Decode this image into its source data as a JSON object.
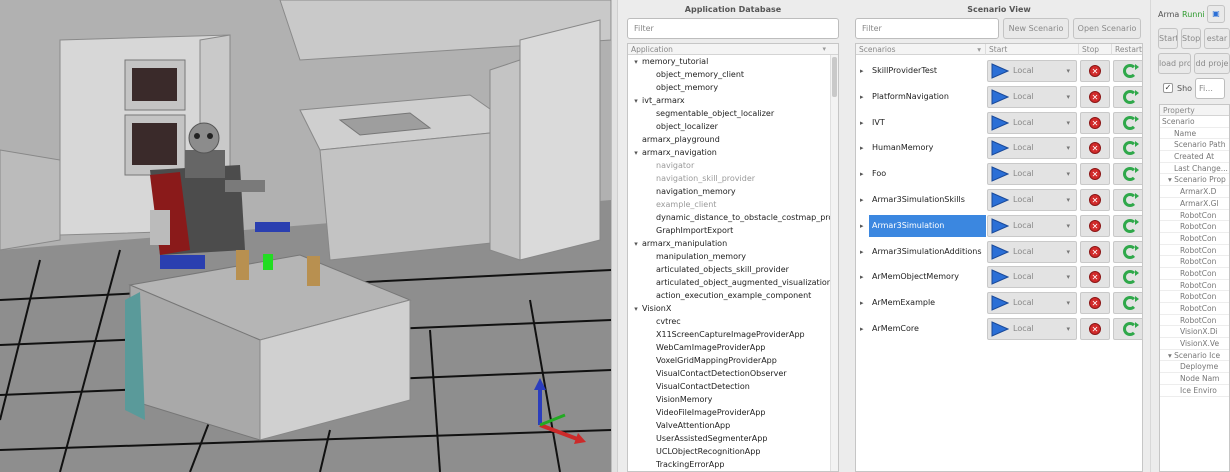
{
  "app_db": {
    "title": "Application Database",
    "filter_placeholder": "Filter",
    "column_header": "Application",
    "tree": [
      {
        "label": "memory_tutorial",
        "level": 0,
        "expanded": true,
        "dim": false
      },
      {
        "label": "object_memory_client",
        "level": 1,
        "dim": false
      },
      {
        "label": "object_memory",
        "level": 1,
        "dim": false
      },
      {
        "label": "ivt_armarx",
        "level": 0,
        "expanded": true,
        "dim": false
      },
      {
        "label": "segmentable_object_localizer",
        "level": 1,
        "dim": false
      },
      {
        "label": "object_localizer",
        "level": 1,
        "dim": false
      },
      {
        "label": "armarx_playground",
        "level": 0,
        "expanded": false,
        "dim": false
      },
      {
        "label": "armarx_navigation",
        "level": 0,
        "expanded": true,
        "dim": false
      },
      {
        "label": "navigator",
        "level": 1,
        "dim": true
      },
      {
        "label": "navigation_skill_provider",
        "level": 1,
        "dim": true
      },
      {
        "label": "navigation_memory",
        "level": 1,
        "dim": false
      },
      {
        "label": "example_client",
        "level": 1,
        "dim": true
      },
      {
        "label": "dynamic_distance_to_obstacle_costmap_pro...",
        "level": 1,
        "dim": false
      },
      {
        "label": "GraphImportExport",
        "level": 1,
        "dim": false
      },
      {
        "label": "armarx_manipulation",
        "level": 0,
        "expanded": true,
        "dim": false
      },
      {
        "label": "manipulation_memory",
        "level": 1,
        "dim": false
      },
      {
        "label": "articulated_objects_skill_provider",
        "level": 1,
        "dim": false
      },
      {
        "label": "articulated_object_augmented_visualization",
        "level": 1,
        "dim": false
      },
      {
        "label": "action_execution_example_component",
        "level": 1,
        "dim": false
      },
      {
        "label": "VisionX",
        "level": 0,
        "expanded": true,
        "dim": false
      },
      {
        "label": "cvtrec",
        "level": 1,
        "dim": false
      },
      {
        "label": "X11ScreenCaptureImageProviderApp",
        "level": 1,
        "dim": false
      },
      {
        "label": "WebCamImageProviderApp",
        "level": 1,
        "dim": false
      },
      {
        "label": "VoxelGridMappingProviderApp",
        "level": 1,
        "dim": false
      },
      {
        "label": "VisualContactDetectionObserver",
        "level": 1,
        "dim": false
      },
      {
        "label": "VisualContactDetection",
        "level": 1,
        "dim": false
      },
      {
        "label": "VisionMemory",
        "level": 1,
        "dim": false
      },
      {
        "label": "VideoFileImageProviderApp",
        "level": 1,
        "dim": false
      },
      {
        "label": "ValveAttentionApp",
        "level": 1,
        "dim": false
      },
      {
        "label": "UserAssistedSegmenterApp",
        "level": 1,
        "dim": false
      },
      {
        "label": "UCLObjectRecognitionApp",
        "level": 1,
        "dim": false
      },
      {
        "label": "TrackingErrorApp",
        "level": 1,
        "dim": false
      }
    ]
  },
  "scenario_view": {
    "title": "Scenario View",
    "filter_placeholder": "Filter",
    "new_button": "New Scenario",
    "open_button": "Open Scenario",
    "headers": {
      "scenarios": "Scenarios",
      "start": "Start",
      "stop": "Stop",
      "restart": "Restart"
    },
    "start_mode": "Local",
    "scenarios": [
      {
        "name": "SkillProviderTest",
        "selected": false
      },
      {
        "name": "PlatformNavigation",
        "selected": false
      },
      {
        "name": "IVT",
        "selected": false
      },
      {
        "name": "HumanMemory",
        "selected": false
      },
      {
        "name": "Foo",
        "selected": false
      },
      {
        "name": "Armar3SimulationSkills",
        "selected": false
      },
      {
        "name": "Armar3Simulation",
        "selected": true
      },
      {
        "name": "Armar3SimulationAdditions",
        "selected": false
      },
      {
        "name": "ArMemObjectMemory",
        "selected": false
      },
      {
        "name": "ArMemExample",
        "selected": false
      },
      {
        "name": "ArMemCore",
        "selected": false
      }
    ]
  },
  "side_panel": {
    "name": "Arma",
    "status": "Runni",
    "status_color": "#2e9b2e",
    "start": "Start",
    "stop": "Stop",
    "restart": "estar",
    "load": "load proj",
    "add": "dd proje",
    "show_label": "Sho",
    "filter_placeholder": "Fi...",
    "property_header": "Property",
    "properties": [
      {
        "label": "Scenario",
        "indent": 0,
        "arrow": ""
      },
      {
        "label": "Name",
        "indent": 2,
        "arrow": ""
      },
      {
        "label": "Scenario Path",
        "indent": 2,
        "arrow": ""
      },
      {
        "label": "Created At",
        "indent": 2,
        "arrow": ""
      },
      {
        "label": "Last Change...",
        "indent": 2,
        "arrow": ""
      },
      {
        "label": "Scenario Prop",
        "indent": 1,
        "arrow": "▾"
      },
      {
        "label": "ArmarX.D",
        "indent": 3,
        "arrow": ""
      },
      {
        "label": "ArmarX.Gl",
        "indent": 3,
        "arrow": ""
      },
      {
        "label": "RobotCon",
        "indent": 3,
        "arrow": ""
      },
      {
        "label": "RobotCon",
        "indent": 3,
        "arrow": ""
      },
      {
        "label": "RobotCon",
        "indent": 3,
        "arrow": ""
      },
      {
        "label": "RobotCon",
        "indent": 3,
        "arrow": ""
      },
      {
        "label": "RobotCon",
        "indent": 3,
        "arrow": ""
      },
      {
        "label": "RobotCon",
        "indent": 3,
        "arrow": ""
      },
      {
        "label": "RobotCon",
        "indent": 3,
        "arrow": ""
      },
      {
        "label": "RobotCon",
        "indent": 3,
        "arrow": ""
      },
      {
        "label": "RobotCon",
        "indent": 3,
        "arrow": ""
      },
      {
        "label": "RobotCon",
        "indent": 3,
        "arrow": ""
      },
      {
        "label": "VisionX.Di",
        "indent": 3,
        "arrow": ""
      },
      {
        "label": "VisionX.Ve",
        "indent": 3,
        "arrow": ""
      },
      {
        "label": "Scenario Ice",
        "indent": 1,
        "arrow": "▾"
      },
      {
        "label": "Deployme",
        "indent": 3,
        "arrow": ""
      },
      {
        "label": "Node Nam",
        "indent": 3,
        "arrow": ""
      },
      {
        "label": "Ice Enviro",
        "indent": 3,
        "arrow": ""
      }
    ]
  },
  "colors": {
    "selection": "#3b87e0",
    "play": "#2b6fd6",
    "stop": "#d12a2a",
    "restart": "#2fa84a"
  }
}
